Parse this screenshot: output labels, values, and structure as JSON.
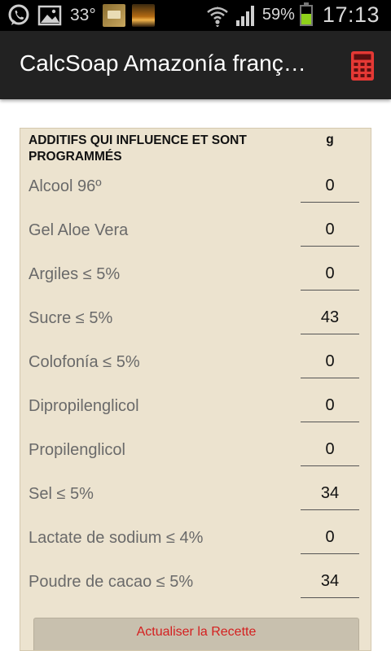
{
  "status_bar": {
    "temperature": "33°",
    "battery_percent": "59%",
    "battery_level": 0.59,
    "time": "17:13",
    "icons": [
      "whatsapp-icon",
      "gallery-icon",
      "bible-app-icon",
      "sunset-thumbnail-icon",
      "wifi-icon",
      "signal-icon",
      "battery-icon"
    ]
  },
  "app_bar": {
    "title": "CalcSoap Amazonía franç…",
    "action_icon": "calculator-icon",
    "accent_color": "#e53935"
  },
  "additives": {
    "header_label": "ADDITIFS QUI INFLUENCE ET SONT PROGRAMMÉS",
    "header_unit": "g",
    "rows": [
      {
        "label": "Alcool 96º",
        "value": "0"
      },
      {
        "label": "Gel Aloe Vera",
        "value": "0"
      },
      {
        "label": "Argiles ≤ 5%",
        "value": "0"
      },
      {
        "label": "Sucre ≤ 5%",
        "value": "43"
      },
      {
        "label": "Colofonía ≤ 5%",
        "value": "0"
      },
      {
        "label": "Dipropilenglicol",
        "value": "0"
      },
      {
        "label": "Propilenglicol",
        "value": "0"
      },
      {
        "label": "Sel ≤ 5%",
        "value": "34"
      },
      {
        "label": "Lactate de sodium ≤ 4%",
        "value": "0"
      },
      {
        "label": "Poudre de cacao ≤ 5%",
        "value": "34"
      }
    ],
    "update_button": "Actualiser la Recette"
  },
  "colors": {
    "panel_background": "#ece3cf",
    "button_text": "#d42020"
  }
}
